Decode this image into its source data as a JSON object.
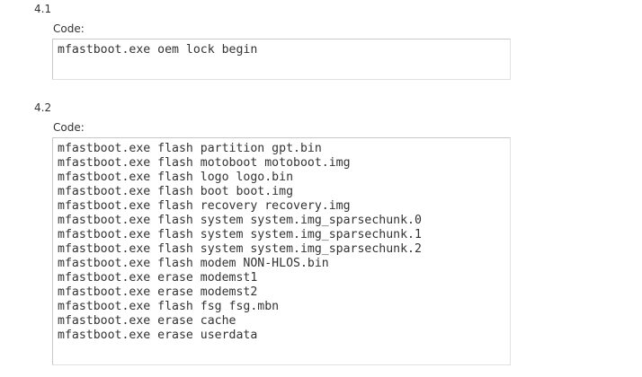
{
  "sections": [
    {
      "number": "4.1",
      "code_label": "Code:",
      "lines": [
        "mfastboot.exe oem lock begin"
      ]
    },
    {
      "number": "4.2",
      "code_label": "Code:",
      "lines": [
        "mfastboot.exe flash partition gpt.bin",
        "mfastboot.exe flash motoboot motoboot.img",
        "mfastboot.exe flash logo logo.bin",
        "mfastboot.exe flash boot boot.img",
        "mfastboot.exe flash recovery recovery.img",
        "mfastboot.exe flash system system.img_sparsechunk.0",
        "mfastboot.exe flash system system.img_sparsechunk.1",
        "mfastboot.exe flash system system.img_sparsechunk.2",
        "mfastboot.exe flash modem NON-HLOS.bin",
        "mfastboot.exe erase modemst1",
        "mfastboot.exe erase modemst2",
        "mfastboot.exe flash fsg fsg.mbn",
        "mfastboot.exe erase cache",
        "mfastboot.exe erase userdata"
      ]
    }
  ]
}
